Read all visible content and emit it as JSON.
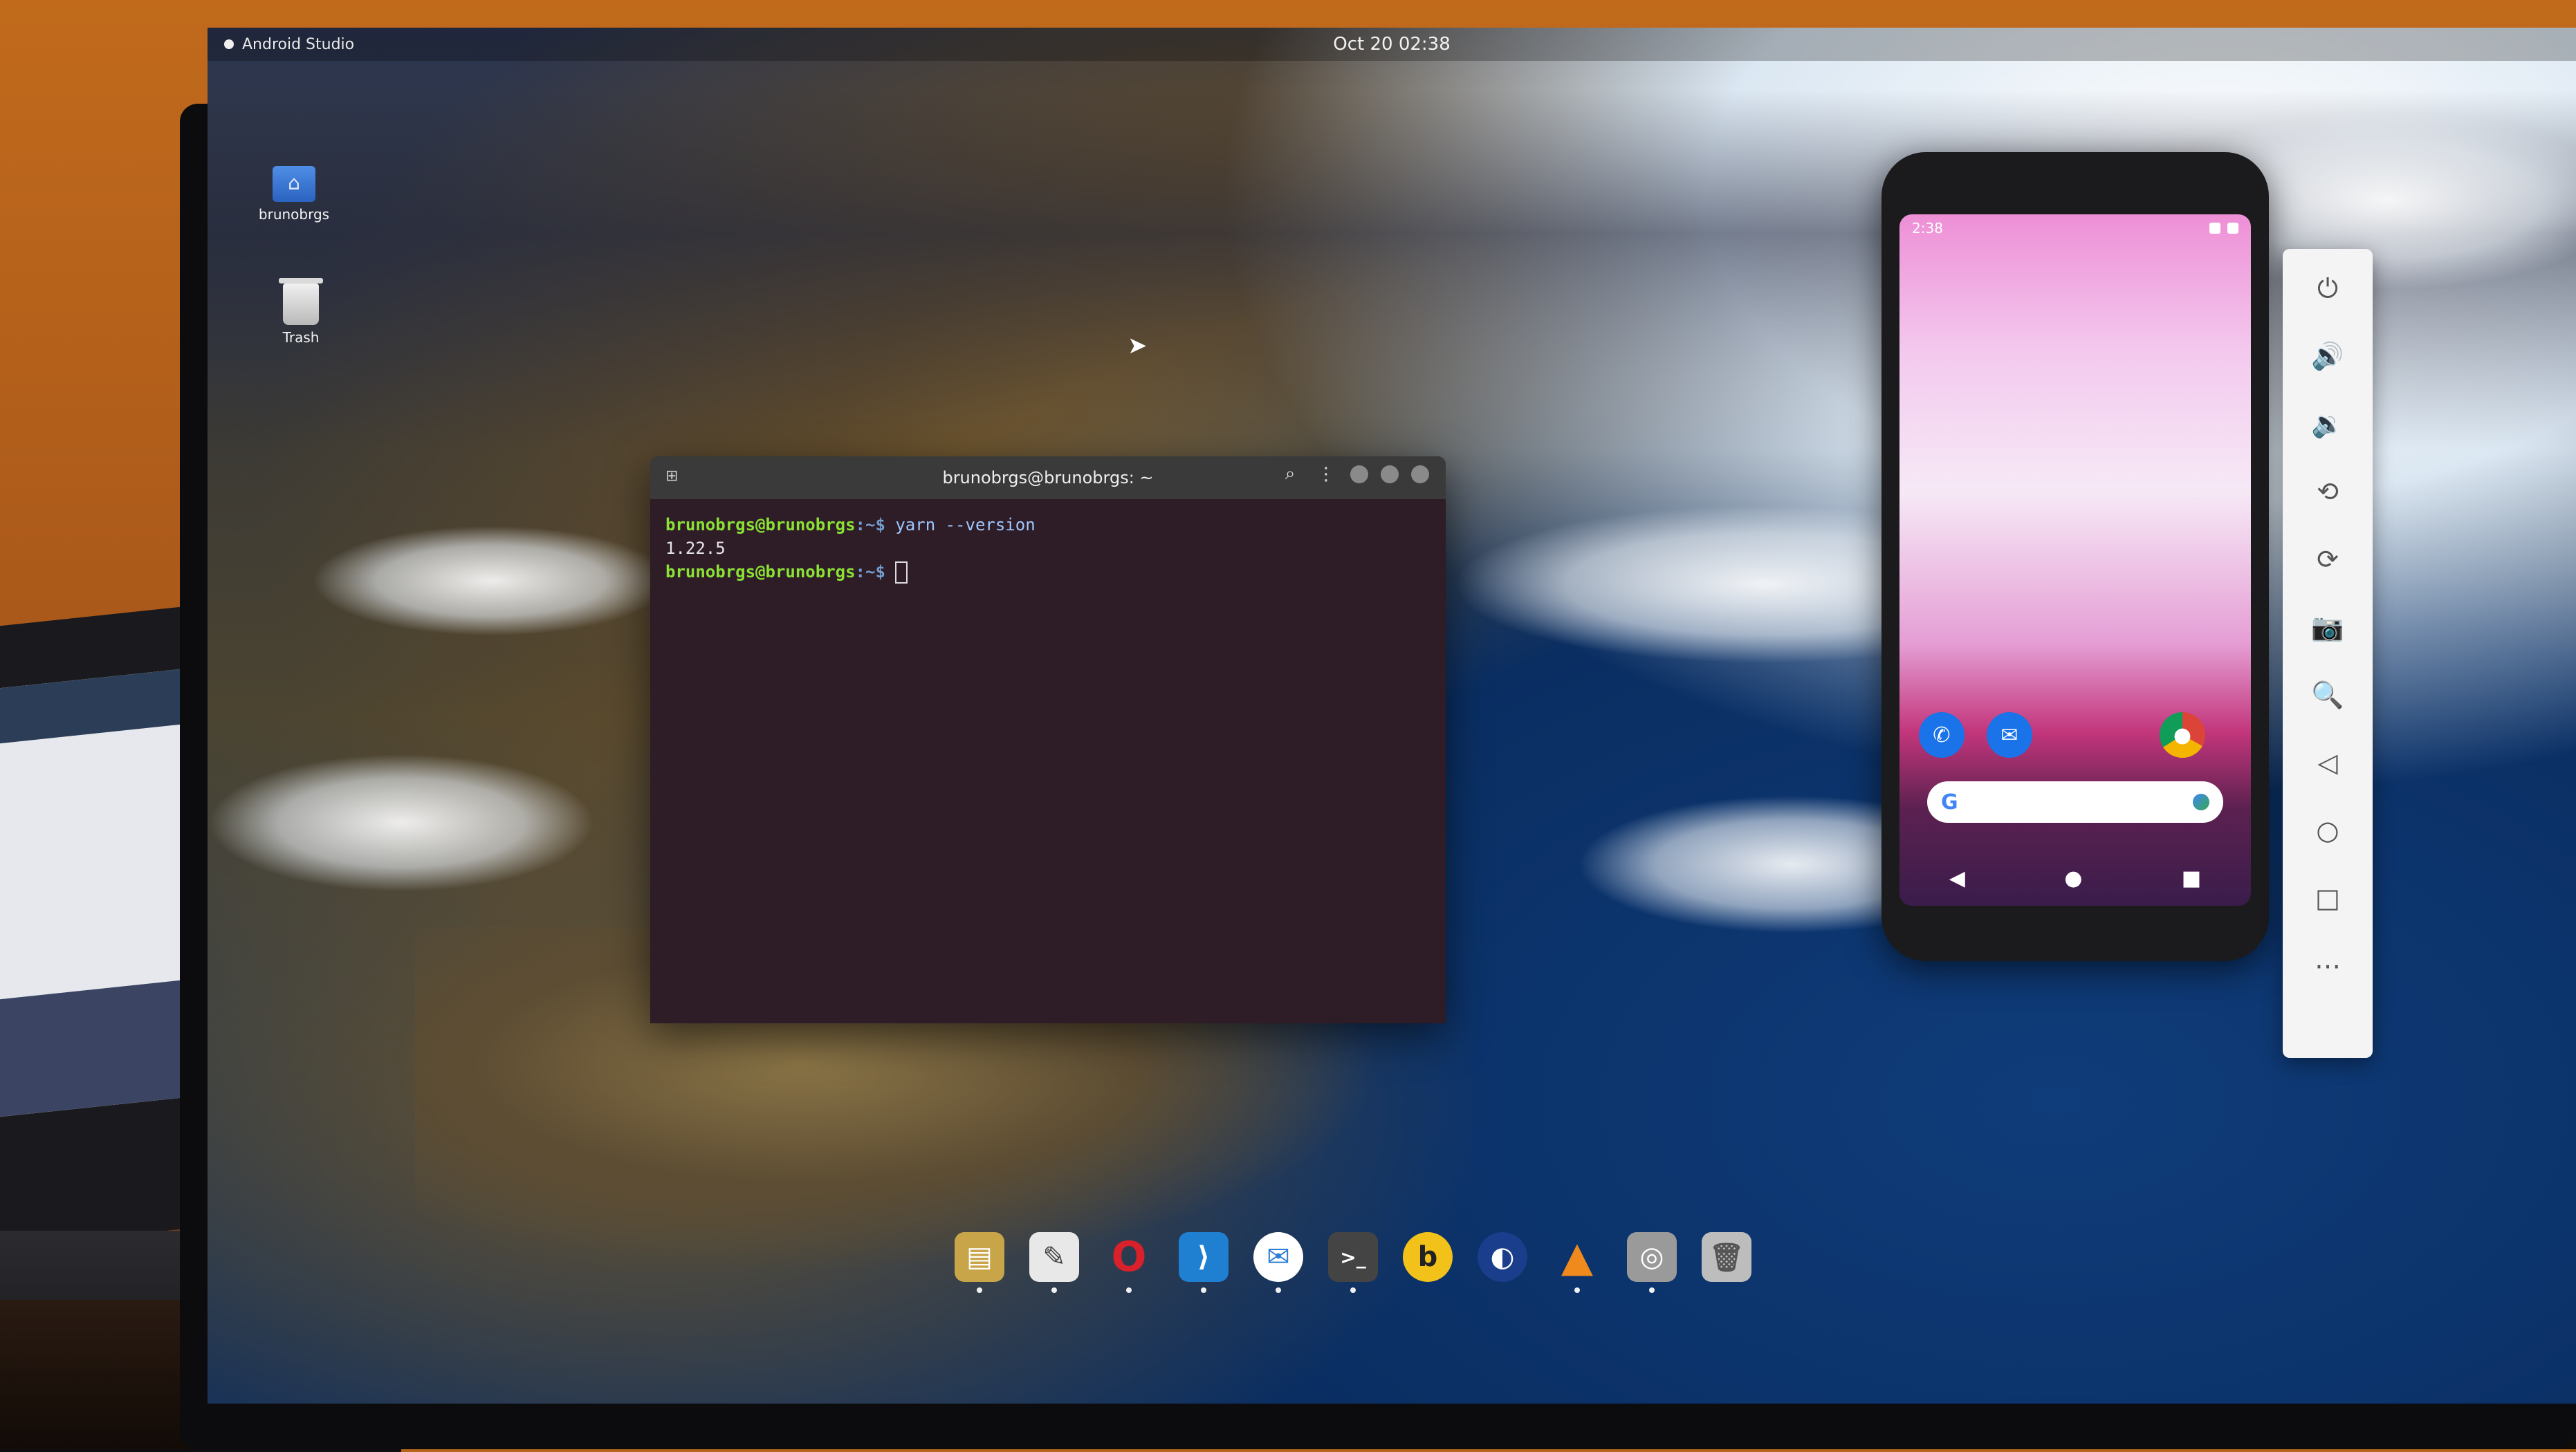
{
  "topbar": {
    "app_name": "Android Studio",
    "clock": "Oct 20  02:38"
  },
  "desktop_icons": [
    {
      "label": "brunobrgs",
      "icon": "home-folder-icon"
    },
    {
      "label": "Trash",
      "icon": "trash-icon"
    }
  ],
  "terminal": {
    "title": "brunobrgs@brunobrgs: ~",
    "lines": [
      {
        "user": "brunobrgs@brunobrgs",
        "path": ":~$",
        "command": " yarn --version"
      },
      {
        "output": "1.22.5"
      },
      {
        "user": "brunobrgs@brunobrgs",
        "path": ":~$",
        "command": ""
      }
    ]
  },
  "phone": {
    "status_time": "2:38",
    "home_apps": [
      {
        "name": "phone-app",
        "color": "#1a73e8",
        "glyph": "✆"
      },
      {
        "name": "messages-app",
        "color": "#1a73e8",
        "glyph": "✉"
      },
      {
        "name": "chrome-app",
        "color": "#db4437",
        "glyph": "◉"
      }
    ],
    "search_logo": "G",
    "nav": {
      "back": "◀",
      "home": "●",
      "recents": "■"
    }
  },
  "emulator_toolbar": [
    {
      "name": "power-icon",
      "glyph": "⏻"
    },
    {
      "name": "volume-up-icon",
      "glyph": "🔊"
    },
    {
      "name": "volume-down-icon",
      "glyph": "🔉"
    },
    {
      "name": "rotate-left-icon",
      "glyph": "⟲"
    },
    {
      "name": "rotate-right-icon",
      "glyph": "⟳"
    },
    {
      "name": "camera-icon",
      "glyph": "📷"
    },
    {
      "name": "zoom-icon",
      "glyph": "🔍"
    },
    {
      "name": "back-icon",
      "glyph": "◁"
    },
    {
      "name": "home-icon",
      "glyph": "○"
    },
    {
      "name": "overview-icon",
      "glyph": "□"
    },
    {
      "name": "more-icon",
      "glyph": "⋯"
    }
  ],
  "dock": [
    {
      "name": "files-icon",
      "color": "#c9a54a",
      "glyph": "▤",
      "running": true
    },
    {
      "name": "text-editor-icon",
      "color": "#e8e8e8",
      "glyph": "✎",
      "running": true
    },
    {
      "name": "opera-icon",
      "color": "#d8212a",
      "glyph": "O",
      "running": true
    },
    {
      "name": "vscode-icon",
      "color": "#1f7fd1",
      "glyph": "⟩",
      "running": true
    },
    {
      "name": "messenger-icon",
      "color": "#2e7ed6",
      "glyph": "✉",
      "running": true
    },
    {
      "name": "terminal-icon",
      "color": "#444444",
      "glyph": ">_",
      "running": true
    },
    {
      "name": "beekeeper-icon",
      "color": "#f2c21b",
      "glyph": "b",
      "running": false
    },
    {
      "name": "eclipse-icon",
      "color": "#1b3e8c",
      "glyph": "◐",
      "running": false
    },
    {
      "name": "vlc-icon",
      "color": "#f08a1c",
      "glyph": "▲",
      "running": true
    },
    {
      "name": "screenshot-icon",
      "color": "#9a9a9a",
      "glyph": "◎",
      "running": true
    },
    {
      "name": "trash-dock-icon",
      "color": "#bdbdbd",
      "glyph": "🗑",
      "running": false
    }
  ]
}
